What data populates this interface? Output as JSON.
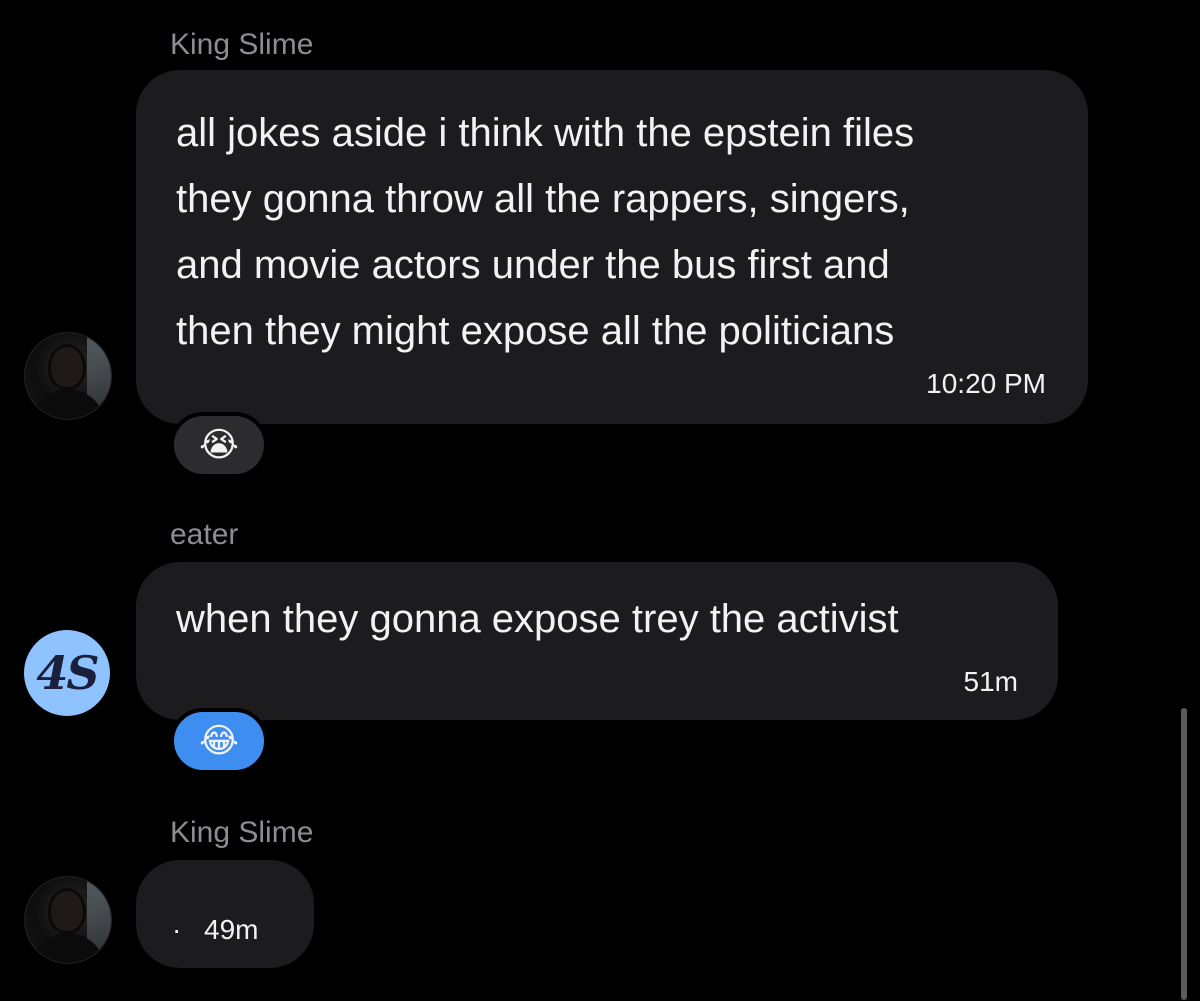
{
  "messages": [
    {
      "sender": "King Slime",
      "text": "all jokes aside i think with the epstein files\nthey gonna throw all the rappers, singers,\nand movie actors under the bus first and\nthen they might expose all the politicians",
      "time": "10:20 PM",
      "reaction": {
        "emoji": "😭",
        "icon": "loudly-crying-face-icon"
      },
      "avatar": "portrait-photo"
    },
    {
      "sender": "eater",
      "text": "when they gonna expose trey the activist",
      "time": "51m",
      "reaction": {
        "emoji": "😂",
        "icon": "face-with-tears-of-joy-icon"
      },
      "avatar": {
        "text": "4S",
        "color": "#8ec3ff"
      }
    },
    {
      "sender": "King Slime",
      "text": "",
      "dot": "·",
      "time": "49m",
      "avatar": "portrait-photo"
    }
  ],
  "colors": {
    "background": "#000000",
    "bubble": "#1c1c1e",
    "sender_name": "#8a8d91",
    "reaction_highlight": "#3d8ef0"
  }
}
